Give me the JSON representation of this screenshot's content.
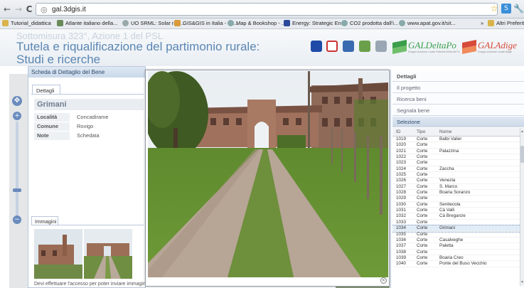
{
  "browser": {
    "url": "gal.3dgis.it",
    "back_icon": "←",
    "forward_icon": "→",
    "reload_icon": "C",
    "bookmarks": [
      {
        "label": "Tutorial_didattica",
        "color": "#d9b44a"
      },
      {
        "label": "Atlante italiano della...",
        "color": "#6a8a5a"
      },
      {
        "label": "UO SRML: Solar radi...",
        "color": "#9aa"
      },
      {
        "label": "GIS&GIS in Italia - Im...",
        "color": "#d99a3a"
      },
      {
        "label": "Map & Bookshop - ...",
        "color": "#8aa"
      },
      {
        "label": "Energy: Strategic En...",
        "color": "#2a4b9a"
      },
      {
        "label": "CO2 prodotta dall'i...",
        "color": "#8aa"
      },
      {
        "label": "www.apat.gov.it/sit...",
        "color": "#8aa"
      }
    ],
    "more_bookmarks": "»",
    "other_bookmarks": "Altri Preferiti"
  },
  "header": {
    "subtitle": "Sottomisura 323°, Azione 1 del PSL",
    "title_line1": "Tutela e riqualificazione del partimonio rurale:",
    "title_line2": "Studi e ricerche",
    "gal1_name": "GALDeltaPo",
    "gal1_tag": "Gruppo di Azione Locale Polesine Delta del Po",
    "gal2_name": "GALAdige",
    "gal2_tag": "Gruppo di Azione Locale Adige"
  },
  "detail": {
    "panel_title": "Scheda di Dettaglio del Bene",
    "tab_details": "Dettagli",
    "name": "Grimani",
    "fields": [
      {
        "key": "Località",
        "value": "Concadirame"
      },
      {
        "key": "Comune",
        "value": "Rovigo"
      },
      {
        "key": "Note",
        "value": "Schedata"
      }
    ],
    "tab_images": "Immagini",
    "access_note": "Devi effettuare l'accesso per poter inviare immagini"
  },
  "right": {
    "sections": [
      "Dettagli",
      "Il progetto",
      "Ricerca beni",
      "Segnala bene"
    ],
    "selection_title": "Selezione",
    "columns": [
      "ID",
      "Tipo",
      "Nome"
    ],
    "rows": [
      [
        "1019",
        "Corte",
        "Balbi Valier"
      ],
      [
        "1020",
        "Corte",
        ""
      ],
      [
        "1021",
        "Corte",
        "Palazzina"
      ],
      [
        "1022",
        "Corte",
        ""
      ],
      [
        "1023",
        "Corte",
        ""
      ],
      [
        "1024",
        "Corte",
        "Zaccha"
      ],
      [
        "1025",
        "Corte",
        ""
      ],
      [
        "1026",
        "Corte",
        "Venezia"
      ],
      [
        "1027",
        "Corte",
        "S. Marco"
      ],
      [
        "1028",
        "Corte",
        "Boaria Soranzo"
      ],
      [
        "1029",
        "Corte",
        ""
      ],
      [
        "1030",
        "Corte",
        "Senitecola"
      ],
      [
        "1031",
        "Corte",
        "Cà Valli"
      ],
      [
        "1032",
        "Corte",
        "Cà Breganze"
      ],
      [
        "1033",
        "Corte",
        ""
      ],
      [
        "1034",
        "Corte",
        "Grimani"
      ],
      [
        "1035",
        "Corte",
        ""
      ],
      [
        "1036",
        "Corte",
        "Casalveghe"
      ],
      [
        "1037",
        "Corte",
        "Paletta"
      ],
      [
        "1038",
        "Corte",
        ""
      ],
      [
        "1039",
        "Corte",
        "Boaria Creo"
      ],
      [
        "1040",
        "Corte",
        "Ponte del Buso Vecchio"
      ]
    ],
    "selected_id": "1034"
  }
}
